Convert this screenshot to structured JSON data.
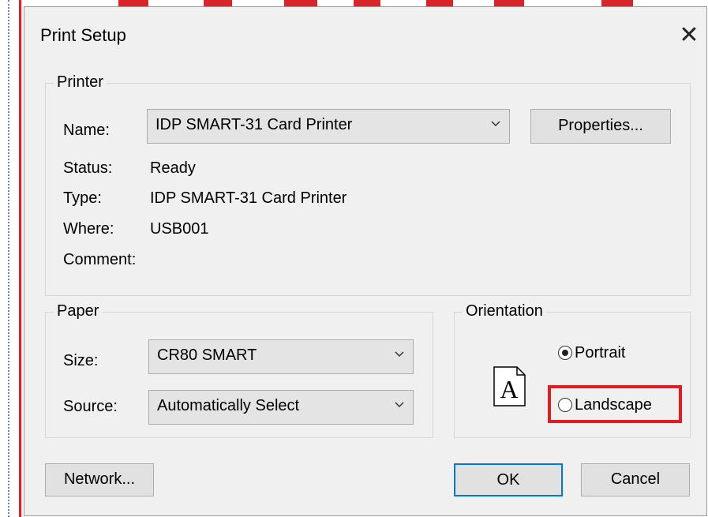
{
  "dialog": {
    "title": "Print Setup",
    "close_glyph": "✕"
  },
  "printer": {
    "group_label": "Printer",
    "name_label": "Name:",
    "name_value": "IDP SMART-31 Card Printer",
    "properties_button": "Properties...",
    "status_label": "Status:",
    "status_value": "Ready",
    "type_label": "Type:",
    "type_value": "IDP SMART-31 Card Printer",
    "where_label": "Where:",
    "where_value": "USB001",
    "comment_label": "Comment:",
    "comment_value": ""
  },
  "paper": {
    "group_label": "Paper",
    "size_label": "Size:",
    "size_value": "CR80 SMART",
    "source_label": "Source:",
    "source_value": "Automatically Select"
  },
  "orientation": {
    "group_label": "Orientation",
    "icon_letter": "A",
    "portrait_label": "Portrait",
    "landscape_label": "Landscape",
    "selected": "Portrait"
  },
  "buttons": {
    "network": "Network...",
    "ok": "OK",
    "cancel": "Cancel"
  },
  "colors": {
    "highlight": "#e21b23",
    "default_button_border": "#0078d7",
    "background_red": "#d9252a"
  }
}
